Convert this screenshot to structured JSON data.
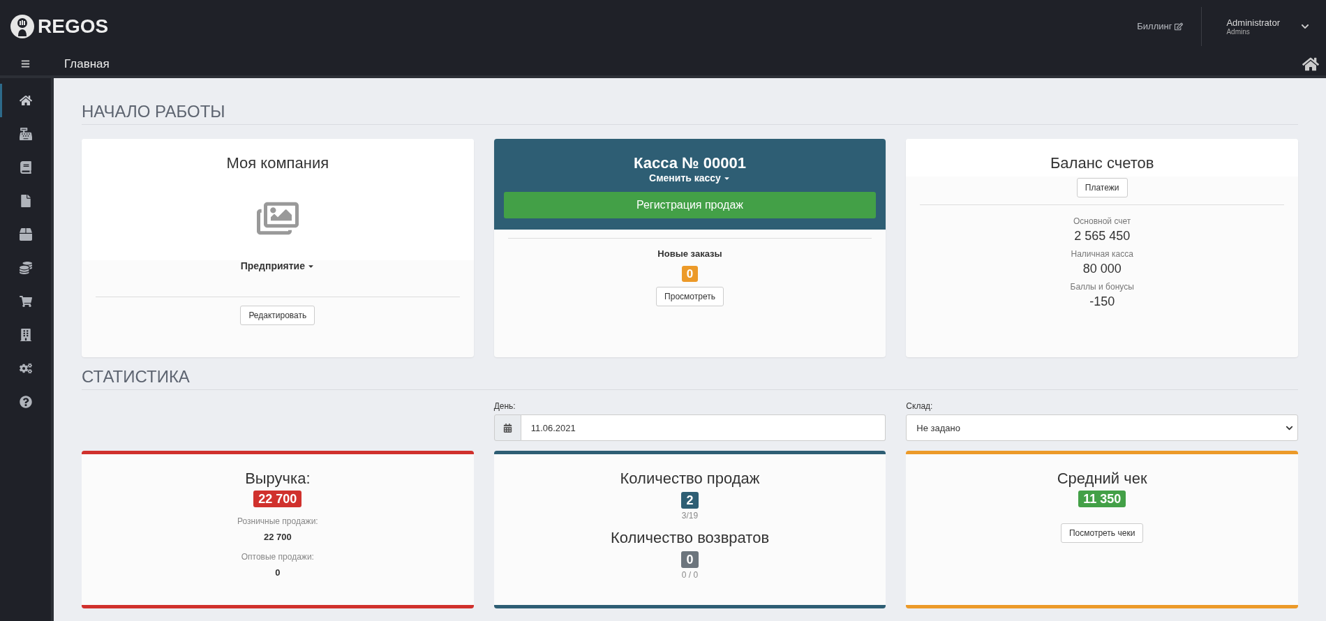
{
  "header": {
    "logo": "REGOS",
    "billing_link": "Биллинг",
    "user": {
      "name": "Administrator",
      "role": "Admins"
    }
  },
  "breadcrumb": {
    "title": "Главная"
  },
  "sidebar": {
    "items": [
      {
        "selected": true
      },
      {
        "selected": false
      },
      {
        "selected": false
      },
      {
        "selected": false
      },
      {
        "selected": false
      },
      {
        "selected": false
      },
      {
        "selected": false
      },
      {
        "selected": false
      },
      {
        "selected": false
      },
      {
        "selected": false
      }
    ]
  },
  "getting_started": {
    "title": "НАЧАЛО РАБОТЫ",
    "company_card": {
      "title": "Моя компания",
      "enterprise_dropdown": "Предприятие",
      "edit_button": "Редактировать"
    },
    "cashbox_card": {
      "title": "Касса № 00001",
      "switch_dropdown": "Сменить кассу",
      "sales_button": "Регистрация продаж",
      "orders_label": "Новые заказы",
      "orders_count": "0",
      "view_button": "Просмотреть"
    },
    "balance_card": {
      "title": "Баланс счетов",
      "payments_button": "Платежи",
      "accounts": [
        {
          "label": "Основной счет",
          "value": "2 565 450"
        },
        {
          "label": "Наличная касса",
          "value": "80 000"
        },
        {
          "label": "Баллы и бонусы",
          "value": "-150"
        }
      ]
    }
  },
  "statistics": {
    "title": "СТАТИСТИКА",
    "day_field": {
      "label": "День:",
      "value": "11.06.2021"
    },
    "warehouse_select": {
      "label": "Склад:",
      "value": "Не задано"
    },
    "cards": [
      {
        "kind": "revenue",
        "color": "#d0312d",
        "title": "Выручка:",
        "value": "22 700",
        "lines": [
          {
            "label": "Розничные продажи:",
            "value": "22 700"
          },
          {
            "label": "Оптовые продажи:",
            "value": "0"
          }
        ]
      },
      {
        "kind": "counts",
        "color": "#2e5e74",
        "metrics": [
          {
            "title": "Количество продаж",
            "value": "2",
            "color": "#2e5e74",
            "note": "3/19"
          },
          {
            "title": "Количество возвратов",
            "value": "0",
            "color": "#6c757d",
            "note": "0 / 0"
          }
        ]
      },
      {
        "kind": "average",
        "color": "#ec9a29",
        "title": "Средний чек",
        "badge": {
          "value": "11 350",
          "color": "#43a047"
        },
        "button": "Посмотреть чеки"
      }
    ]
  }
}
